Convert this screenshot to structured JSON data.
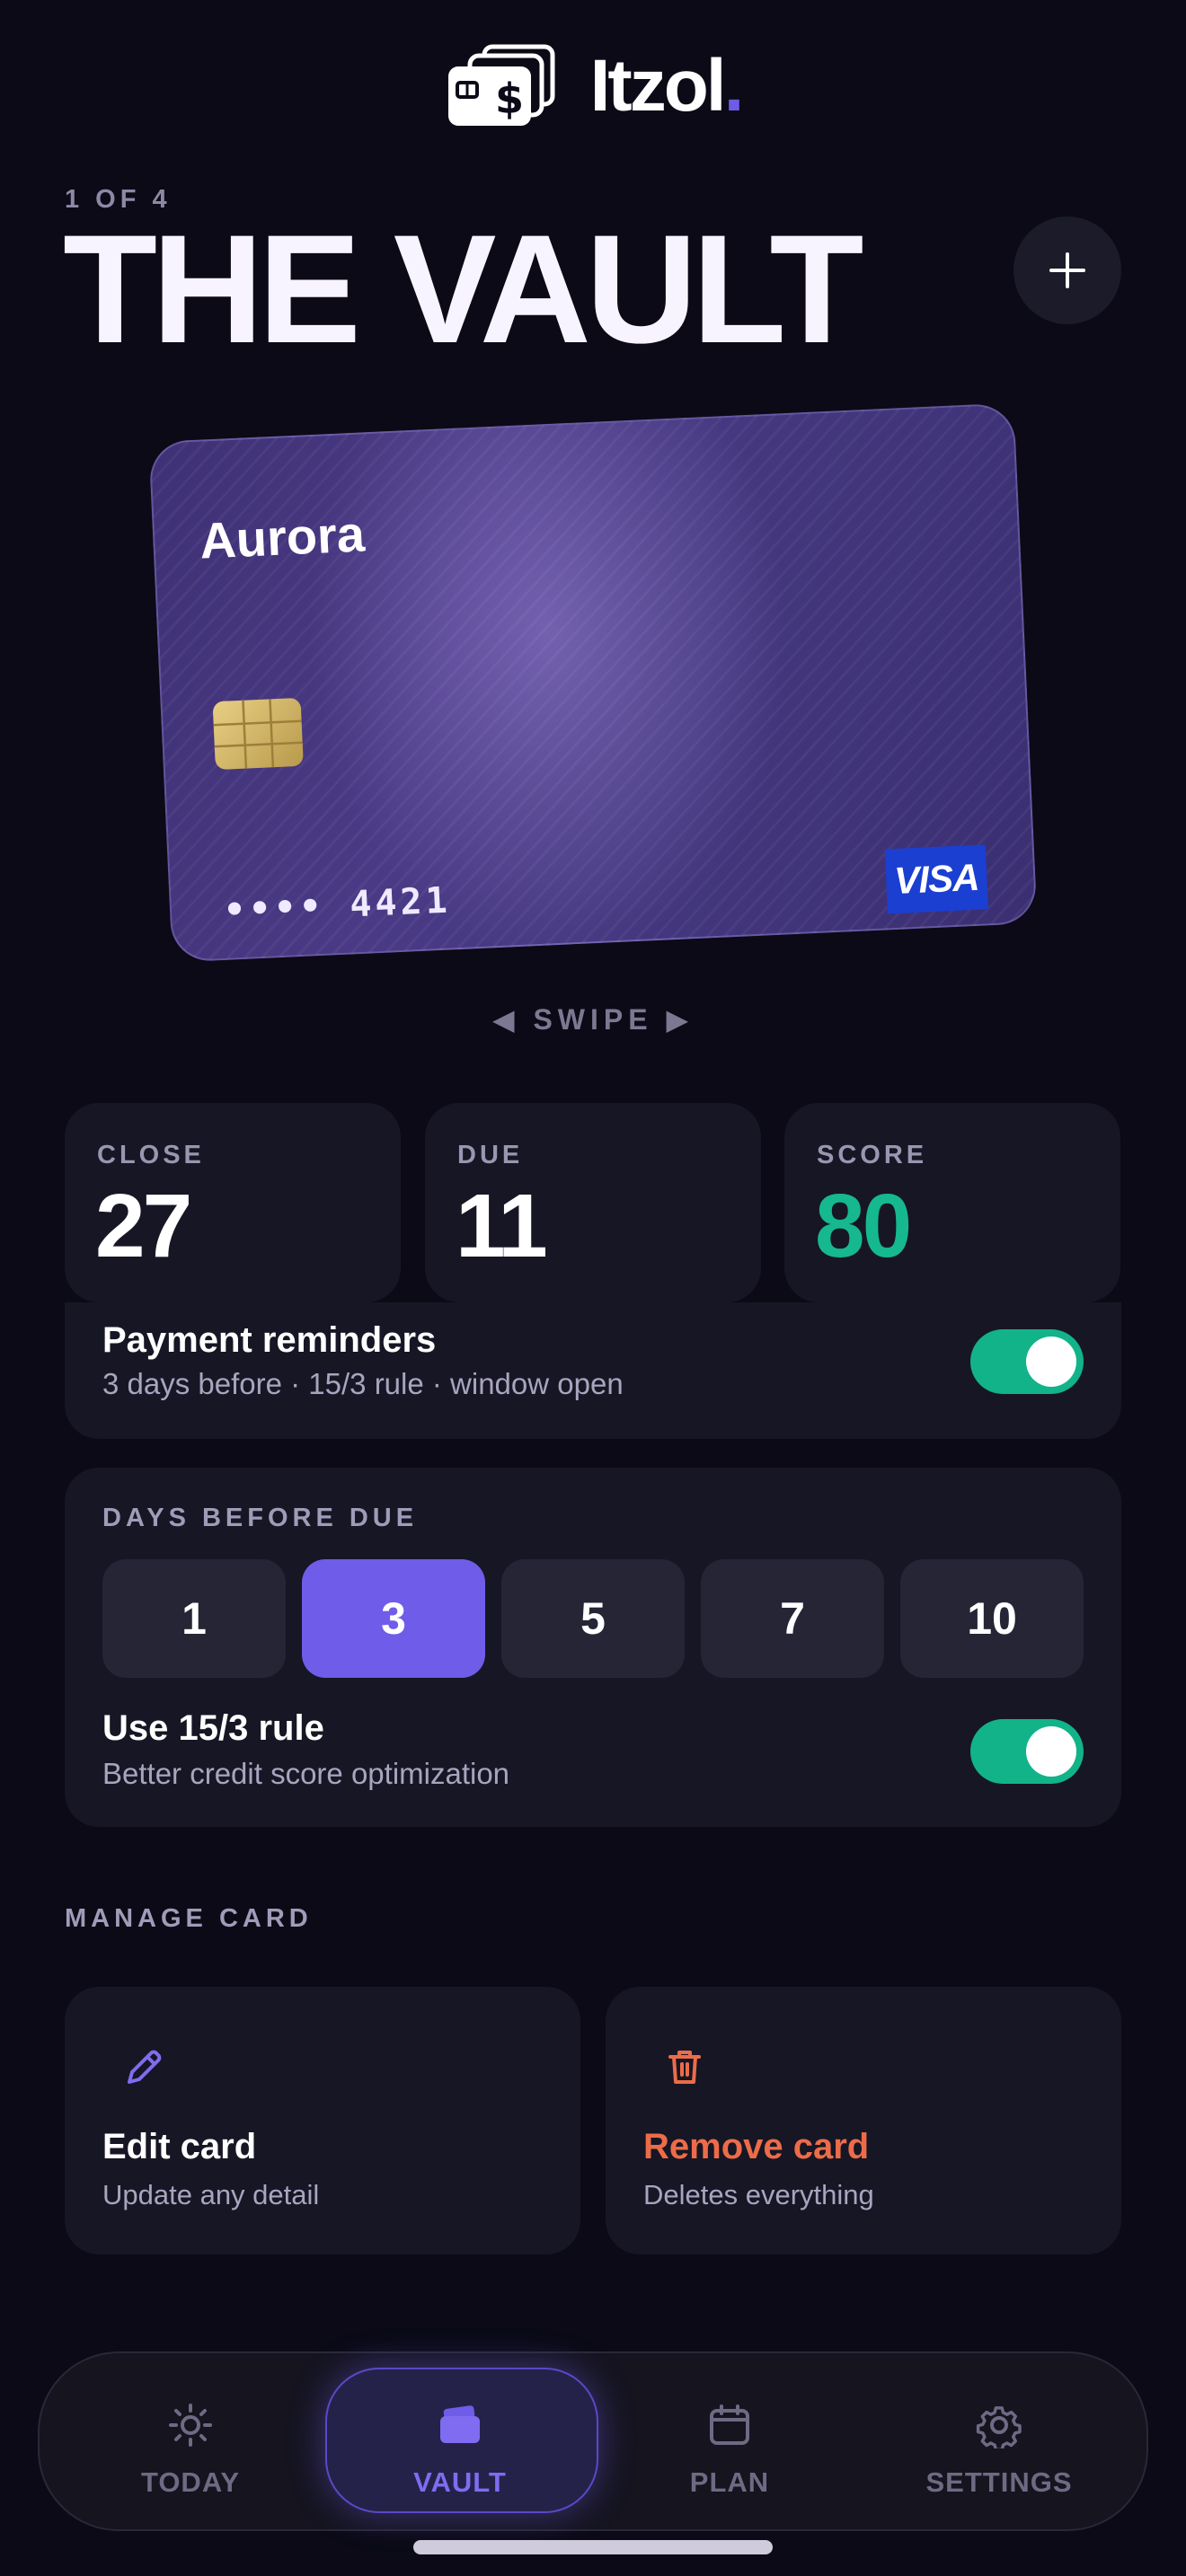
{
  "header": {
    "brand": "Itzol",
    "brand_dot": ".",
    "logo_icon": "stacked-cards-dollar-icon"
  },
  "title": {
    "counter": "1 OF 4",
    "heading": "THE VAULT",
    "add_icon": "plus-icon"
  },
  "card": {
    "name": "Aurora",
    "number": "•••• 4421",
    "network": "VISA"
  },
  "swipe_hint": "◀ SWIPE ▶",
  "stats": [
    {
      "label": "CLOSE",
      "value": "27"
    },
    {
      "label": "DUE",
      "value": "11"
    },
    {
      "label": "SCORE",
      "value": "80"
    }
  ],
  "reminders": {
    "title": "Payment reminders",
    "subtitle": "3 days before · 15/3 rule · window open",
    "enabled": true
  },
  "days_before_due": {
    "label": "DAYS BEFORE DUE",
    "options": [
      "1",
      "3",
      "5",
      "7",
      "10"
    ],
    "selected": "3",
    "rule_title": "Use 15/3 rule",
    "rule_subtitle": "Better credit score optimization",
    "rule_enabled": true
  },
  "manage": {
    "label": "MANAGE CARD",
    "edit_title": "Edit card",
    "edit_sub": "Update any detail",
    "remove_title": "Remove card",
    "remove_sub": "Deletes everything"
  },
  "nav": [
    {
      "label": "TODAY",
      "icon": "sun-icon"
    },
    {
      "label": "VAULT",
      "icon": "wallet-icon",
      "active": true
    },
    {
      "label": "PLAN",
      "icon": "calendar-icon"
    },
    {
      "label": "SETTINGS",
      "icon": "gear-icon"
    }
  ],
  "colors": {
    "background": "#0b0a16",
    "accent": "#6f5ce8",
    "success": "#12b389",
    "danger": "#ec6c49"
  }
}
